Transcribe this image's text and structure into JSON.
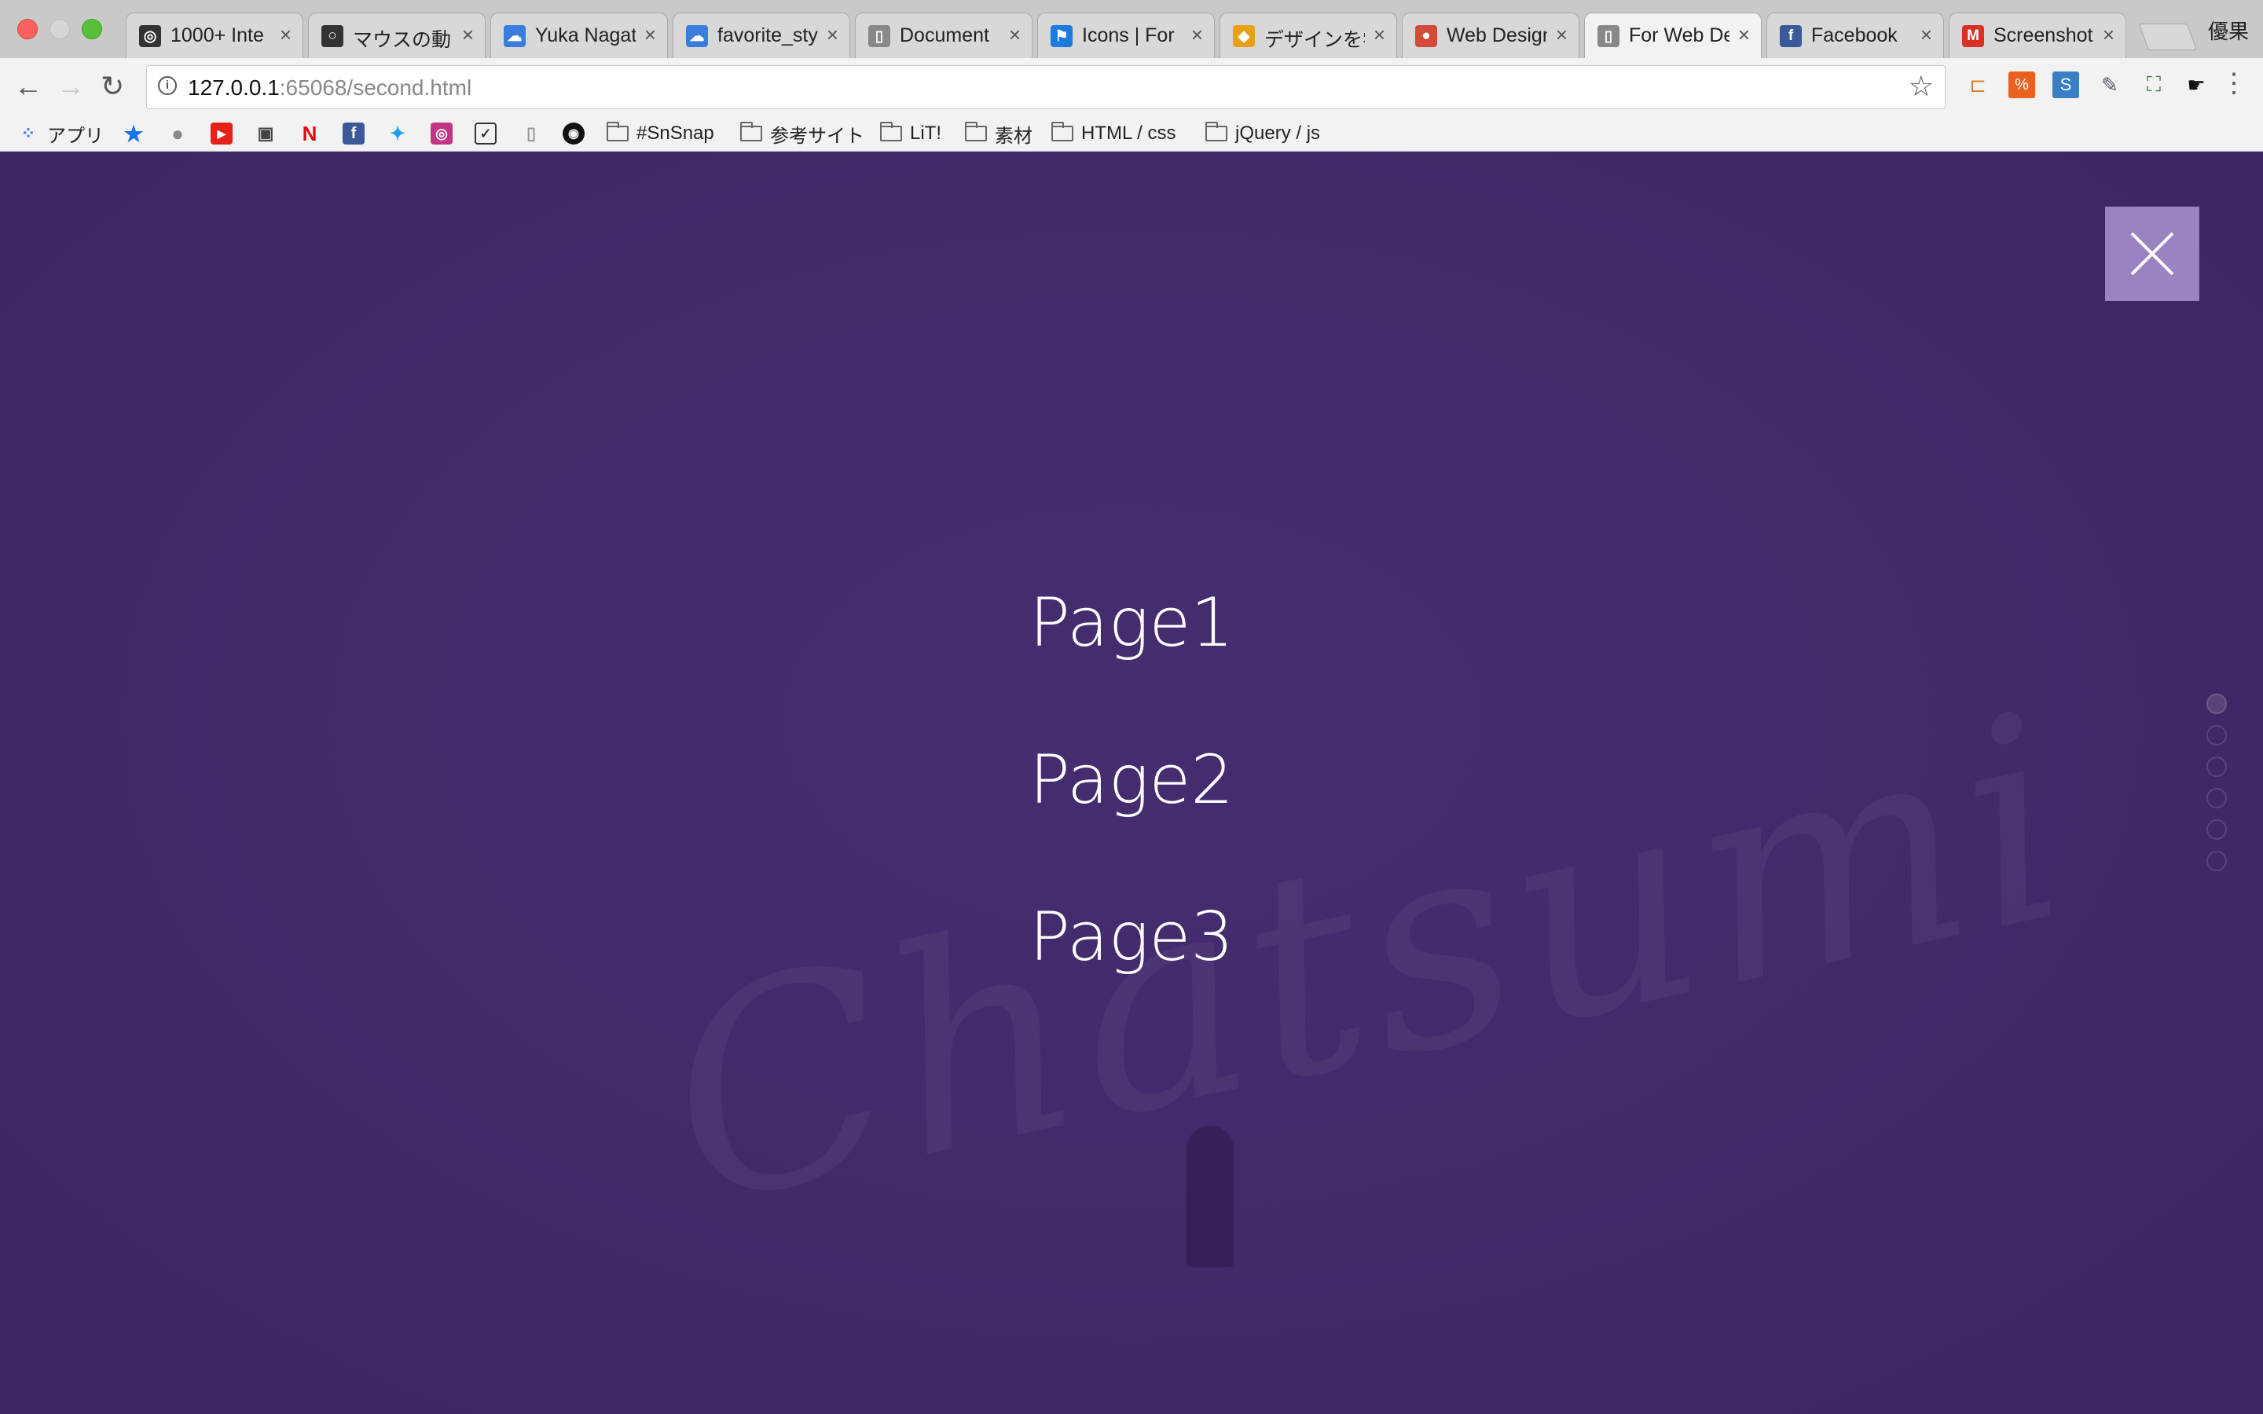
{
  "tabs": [
    {
      "title": "1000+ Inte",
      "icon": "instagram-icon",
      "color": "#333333",
      "glyph": "◎"
    },
    {
      "title": "マウスの動き",
      "icon": "circle-icon",
      "color": "#333333",
      "glyph": "○"
    },
    {
      "title": "Yuka Nagat",
      "icon": "cloud-icon",
      "color": "#3b7ddd",
      "glyph": "☁"
    },
    {
      "title": "favorite_sty",
      "icon": "cloud-icon",
      "color": "#3b7ddd",
      "glyph": "☁"
    },
    {
      "title": "Document",
      "icon": "document-icon",
      "color": "#888888",
      "glyph": "▯"
    },
    {
      "title": "Icons | For",
      "icon": "flag-icon",
      "color": "#1b7bde",
      "glyph": "⚑"
    },
    {
      "title": "デザインを学",
      "icon": "colorful-icon",
      "color": "#e8a015",
      "glyph": "◆"
    },
    {
      "title": "Web Design",
      "icon": "chrome-icon",
      "color": "#d44b3a",
      "glyph": "●"
    },
    {
      "title": "For Web De",
      "icon": "document-icon",
      "color": "#888888",
      "glyph": "▯",
      "active": true
    },
    {
      "title": "Facebook",
      "icon": "facebook-icon",
      "color": "#3b5998",
      "glyph": "f"
    },
    {
      "title": "Screenshot",
      "icon": "gmail-icon",
      "color": "#d93025",
      "glyph": "M"
    }
  ],
  "profile_name": "優果",
  "address": {
    "host": "127.0.0.1",
    "path": ":65068/second.html"
  },
  "bookmarks": {
    "apps_label": "アプリ",
    "folders": [
      "#SnSnap",
      "参考サイト",
      "LiT!",
      "素材",
      "HTML / css",
      "jQuery / js"
    ]
  },
  "menu": {
    "page1": "Page1",
    "page2": "Page2",
    "page3": "Page3"
  },
  "page_indicator": {
    "count": 6,
    "active_index": 0
  }
}
